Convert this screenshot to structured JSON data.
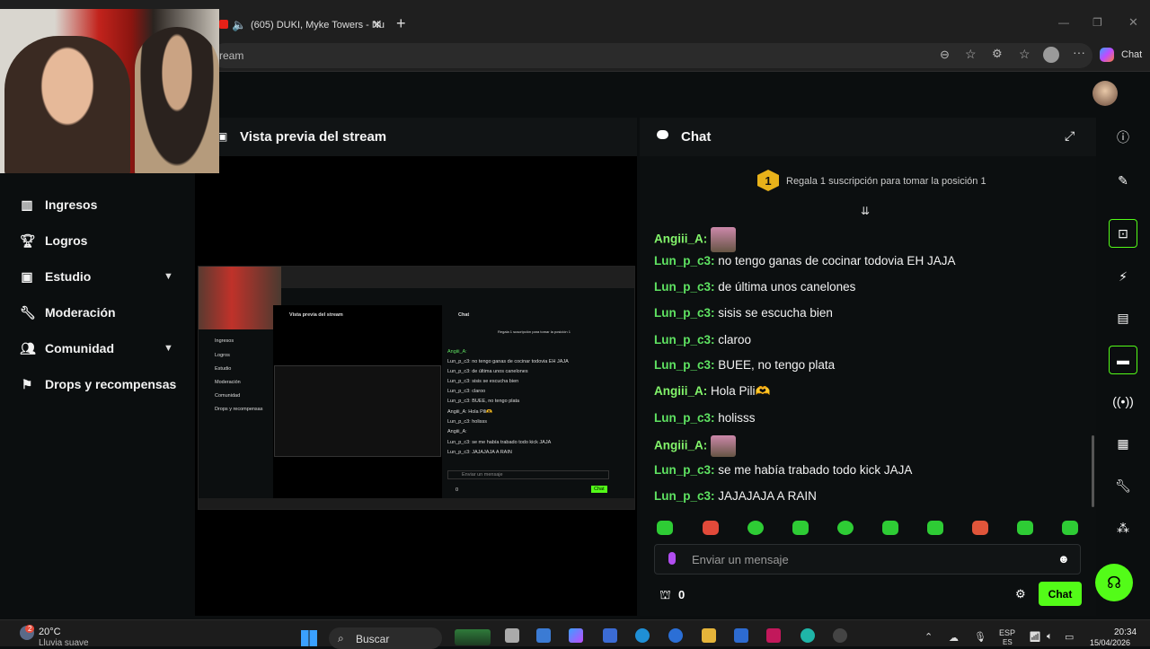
{
  "browser": {
    "tab_title": "(605) DUKI, Myke Towers - Nu",
    "address_text": "ream",
    "copilot_label": "Chat"
  },
  "sidebar": {
    "items": [
      {
        "label": "Ingresos",
        "icon": "bar-chart-icon"
      },
      {
        "label": "Logros",
        "icon": "trophy-icon"
      },
      {
        "label": "Estudio",
        "icon": "studio-icon",
        "expandable": true
      },
      {
        "label": "Moderación",
        "icon": "wrench-icon"
      },
      {
        "label": "Comunidad",
        "icon": "users-icon",
        "expandable": true
      },
      {
        "label": "Drops y recompensas",
        "icon": "drops-icon"
      }
    ]
  },
  "preview": {
    "title": "Vista previa del stream"
  },
  "chat": {
    "title": "Chat",
    "gift_banner": "Regala 1 suscripción para tomar la posición 1",
    "gift_rank": "1",
    "messages": [
      {
        "user": "Angiii_A",
        "text": ""
      },
      {
        "user": "Lun_p_c3",
        "text": "no tengo ganas de cocinar todovia EH JAJA"
      },
      {
        "user": "Lun_p_c3",
        "text": "de última unos canelones"
      },
      {
        "user": "Lun_p_c3",
        "text": "sisis se escucha bien"
      },
      {
        "user": "Lun_p_c3",
        "text": "claroo"
      },
      {
        "user": "Lun_p_c3",
        "text": "BUEE, no tengo plata"
      },
      {
        "user": "Angiii_A",
        "text": "Hola Pili🫶"
      },
      {
        "user": "Lun_p_c3",
        "text": "holisss"
      },
      {
        "user": "Angiii_A",
        "text": ""
      },
      {
        "user": "Lun_p_c3",
        "text": "se me había trabado todo kick JAJA"
      },
      {
        "user": "Lun_p_c3",
        "text": "JAJAJAJA A RAIN"
      }
    ],
    "input_placeholder": "Enviar un mensaje",
    "points": "0",
    "send_label": "Chat"
  },
  "nested": {
    "preview_title": "Vista previa del stream",
    "chat_title": "Chat",
    "banner": "Regala 1 suscripción para tomar la posición 1",
    "nav": [
      "Ingresos",
      "Logros",
      "Estudio",
      "Moderación",
      "Comunidad",
      "Drops y recompensas"
    ],
    "messages": [
      "Angiii_A:",
      "Lun_p_c3: no tengo ganas de cocinar todovia EH JAJA",
      "Lun_p_c3: de última unos canelones",
      "Lun_p_c3: sisis se escucha bien",
      "Lun_p_c3: claroo",
      "Lun_p_c3: BUEE, no tengo plata",
      "Angiii_A: Hola Pili🫶",
      "Lun_p_c3: holisss",
      "Angiii_A:",
      "Lun_p_c3: se me había trabado todo kick JAJA",
      "Lun_p_c3: JAJAJAJA A RAIN"
    ],
    "placeholder": "Enviar un mensaje",
    "points": "0",
    "send": "Chat"
  },
  "taskbar": {
    "weather_temp": "20°C",
    "weather_desc": "Lluvia suave",
    "search": "Buscar",
    "lang": "ESP",
    "lang2": "ES",
    "time": "20:34",
    "date": "15/04/2026",
    "weather_badge": "2"
  },
  "colors": {
    "accent": "#53fc18",
    "username": "#5fe362",
    "bg": "#0b0e0f"
  }
}
